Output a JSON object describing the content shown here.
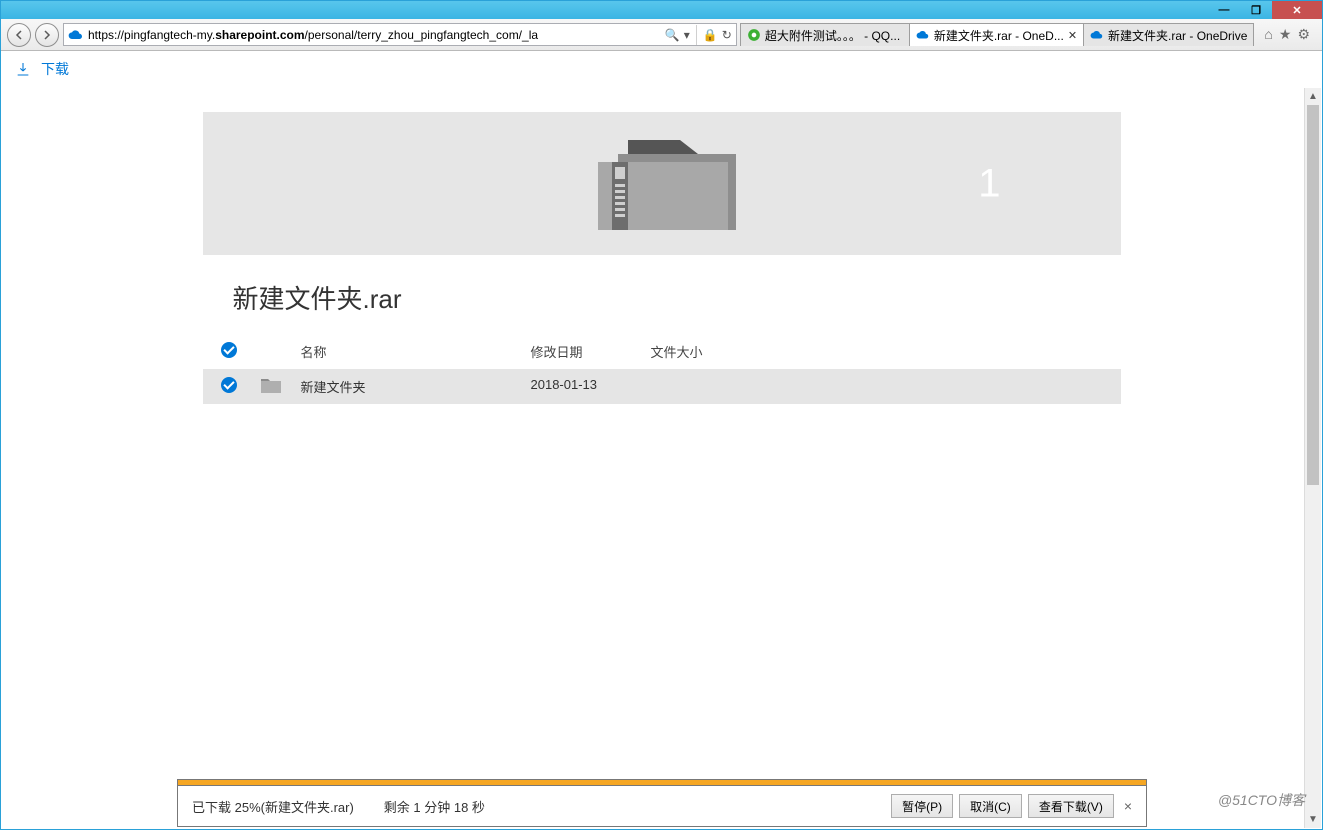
{
  "window": {
    "minimize": "—",
    "maximize": "❐",
    "close": "✕"
  },
  "address": {
    "url_prefix": "https://pingfangtech-my.",
    "url_bold": "sharepoint.com",
    "url_suffix": "/personal/terry_zhou_pingfangtech_com/_la",
    "search_glyph": "🔍"
  },
  "tabs": [
    {
      "label": "超大附件测试。。。 - QQ...",
      "active": false,
      "icon": "qq"
    },
    {
      "label": "新建文件夹.rar - OneD...",
      "active": true,
      "icon": "onedrive"
    },
    {
      "label": "新建文件夹.rar - OneDrive",
      "active": false,
      "icon": "onedrive"
    }
  ],
  "toolbar": {
    "download": "下载"
  },
  "banner": {
    "count": "1"
  },
  "page": {
    "title": "新建文件夹.rar",
    "columns": {
      "name": "名称",
      "date": "修改日期",
      "size": "文件大小"
    },
    "rows": [
      {
        "name": "新建文件夹",
        "date": "2018-01-13",
        "size": ""
      }
    ]
  },
  "download_bar": {
    "status": "已下载 25%(新建文件夹.rar)",
    "remaining": "剩余  1 分钟 18 秒",
    "pause": "暂停(P)",
    "cancel": "取消(C)",
    "view": "查看下载(V)",
    "dismiss": "×"
  },
  "watermark": "@51CTO博客"
}
